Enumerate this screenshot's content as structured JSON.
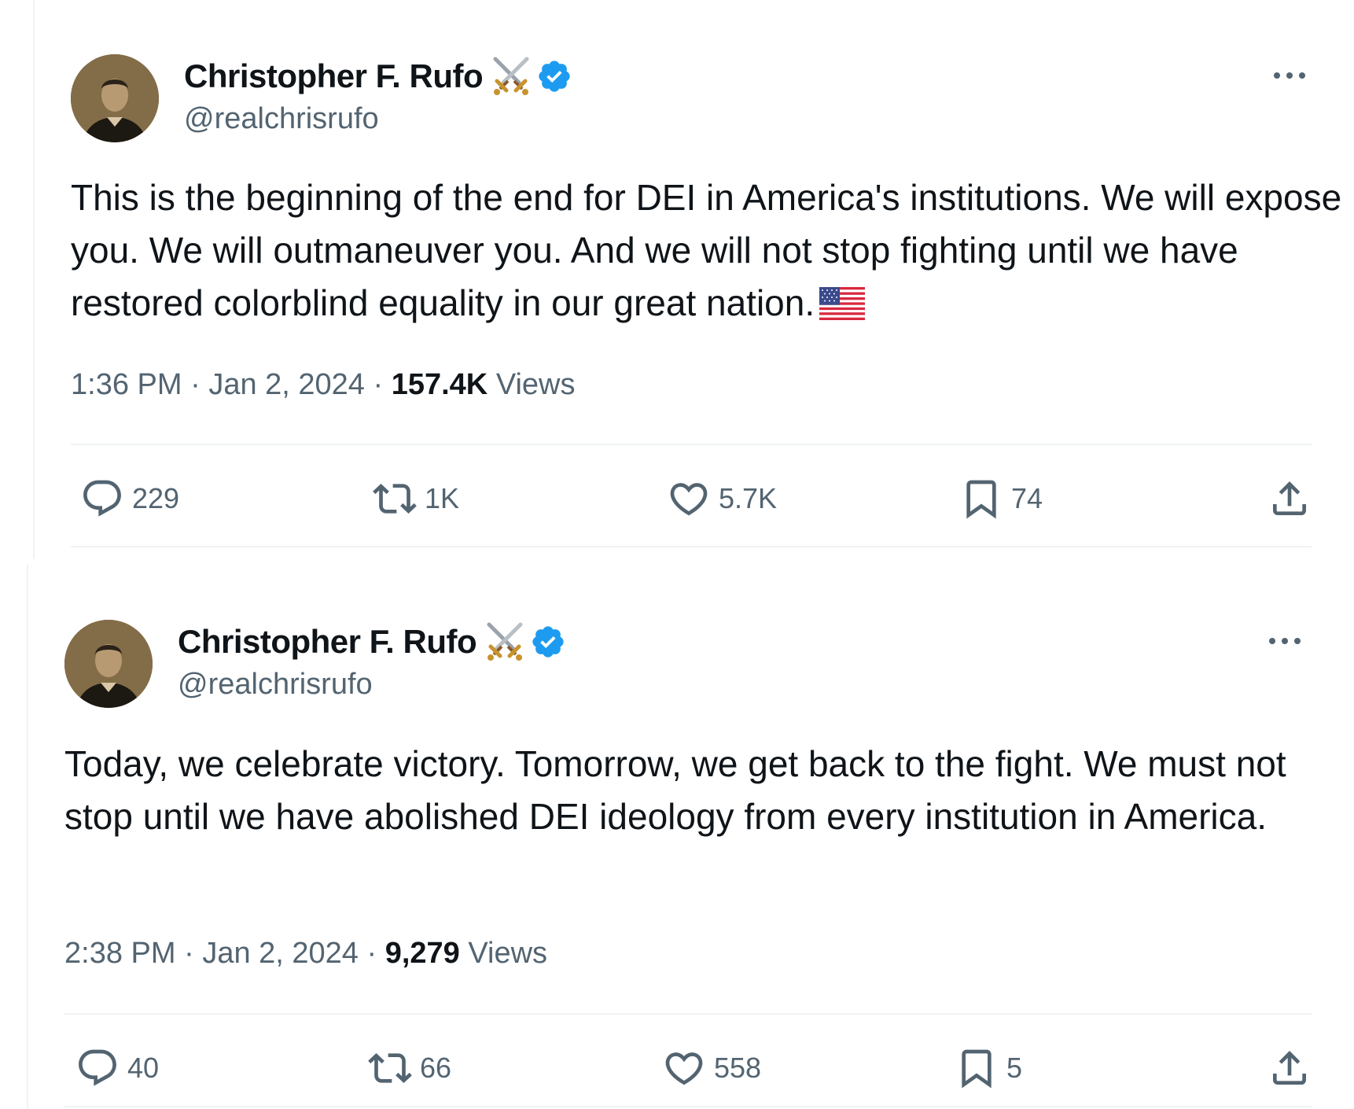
{
  "tweets": [
    {
      "author": {
        "display_name": "Christopher F. Rufo",
        "handle": "@realchrisrufo",
        "name_emoji": "swords-icon",
        "verified": true
      },
      "text": "This is the beginning of the end for DEI in America's institutions. We will expose you. We will outmaneuver you. And we will not stop fighting until we have restored colorblind equality in our great nation.",
      "text_emoji": "us-flag-icon",
      "time": "1:36 PM",
      "date": "Jan 2, 2024",
      "separator": "·",
      "views_count": "157.4K",
      "views_label": "Views",
      "actions": {
        "replies": "229",
        "reposts": "1K",
        "likes": "5.7K",
        "bookmarks": "74"
      }
    },
    {
      "author": {
        "display_name": "Christopher F. Rufo",
        "handle": "@realchrisrufo",
        "name_emoji": "swords-icon",
        "verified": true
      },
      "text": "Today, we celebrate victory. Tomorrow, we get back to the fight. We must not stop until we have abolished DEI ideology from every institution in America.",
      "time": "2:38 PM",
      "date": "Jan 2, 2024",
      "separator": "·",
      "views_count": "9,279",
      "views_label": "Views",
      "actions": {
        "replies": "40",
        "reposts": "66",
        "likes": "558",
        "bookmarks": "5"
      }
    }
  ],
  "colors": {
    "text": "#0f1419",
    "secondary": "#536471",
    "verified": "#1d9bf0",
    "divider": "#eff3f4"
  }
}
